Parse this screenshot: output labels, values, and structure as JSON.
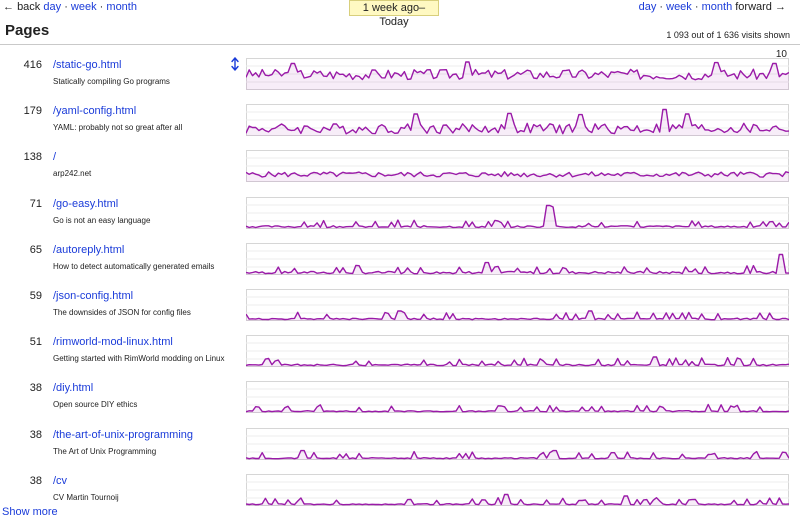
{
  "nav": {
    "back_arrow": "←",
    "back_label": "back",
    "day": "day",
    "sep": "·",
    "week": "week",
    "month": "month",
    "forward_label": "forward",
    "forward_arrow": "→"
  },
  "range_label": "1 week ago–Today",
  "heading": "Pages",
  "summary": "1 093 out of 1 636 visits shown",
  "chart_scale_max": "10",
  "accent": "#9a1aa8",
  "link_color": "#1a3bd9",
  "sort_icon": "up-down-arrow-icon",
  "pages": [
    {
      "count": "416",
      "path": "/static-go.html",
      "title": "Statically compiling Go programs"
    },
    {
      "count": "179",
      "path": "/yaml-config.html",
      "title": "YAML: probably not so great after all"
    },
    {
      "count": "138",
      "path": "/",
      "title": "arp242.net"
    },
    {
      "count": "71",
      "path": "/go-easy.html",
      "title": "Go is not an easy language"
    },
    {
      "count": "65",
      "path": "/autoreply.html",
      "title": "How to detect automatically generated emails"
    },
    {
      "count": "59",
      "path": "/json-config.html",
      "title": "The downsides of JSON for config files"
    },
    {
      "count": "51",
      "path": "/rimworld-mod-linux.html",
      "title": "Getting started with RimWorld modding on Linux"
    },
    {
      "count": "38",
      "path": "/diy.html",
      "title": "Open source DIY ethics"
    },
    {
      "count": "38",
      "path": "/the-art-of-unix-programming",
      "title": "The Art of Unix Programming"
    },
    {
      "count": "38",
      "path": "/cv",
      "title": "CV Martin Tournoij"
    }
  ],
  "show_more": "Show more"
}
